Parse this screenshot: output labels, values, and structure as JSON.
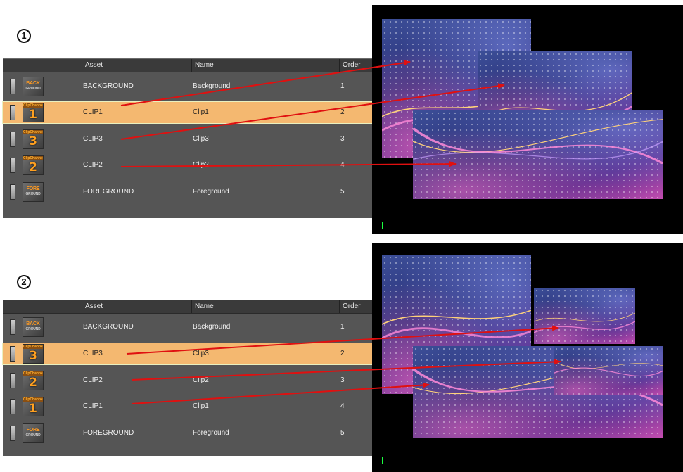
{
  "colors": {
    "panel": "#555555",
    "header": "#3a3a3a",
    "selected_row": "#f4b870",
    "arrow": "#e01010",
    "thumb_orange": "#ffa020"
  },
  "steps": [
    {
      "badge": "1",
      "columns": {
        "asset": "Asset",
        "name": "Name",
        "order": "Order"
      },
      "rows": [
        {
          "thumb": "background-thumb-icon",
          "thumb_text": "BACK",
          "thumb_sub": "GROUND",
          "asset": "BACKGROUND",
          "name": "Background",
          "order": "1",
          "selected": false
        },
        {
          "thumb": "clip-thumb-icon",
          "thumb_tag": "ClipChannel",
          "thumb_num": "1",
          "asset": "CLIP1",
          "name": "Clip1",
          "order": "2",
          "selected": true
        },
        {
          "thumb": "clip-thumb-icon",
          "thumb_tag": "ClipChannel",
          "thumb_num": "3",
          "asset": "CLIP3",
          "name": "Clip3",
          "order": "3",
          "selected": false
        },
        {
          "thumb": "clip-thumb-icon",
          "thumb_tag": "ClipChannel",
          "thumb_num": "2",
          "asset": "CLIP2",
          "name": "Clip2",
          "order": "4",
          "selected": false
        },
        {
          "thumb": "foreground-thumb-icon",
          "thumb_text": "FORE",
          "thumb_sub": "GROUND",
          "asset": "FOREGROUND",
          "name": "Foreground",
          "order": "5",
          "selected": false
        }
      ]
    },
    {
      "badge": "2",
      "columns": {
        "asset": "Asset",
        "name": "Name",
        "order": "Order"
      },
      "rows": [
        {
          "thumb": "background-thumb-icon",
          "thumb_text": "BACK",
          "thumb_sub": "GROUND",
          "asset": "BACKGROUND",
          "name": "Background",
          "order": "1",
          "selected": false
        },
        {
          "thumb": "clip-thumb-icon",
          "thumb_tag": "ClipChannel",
          "thumb_num": "3",
          "asset": "CLIP3",
          "name": "Clip3",
          "order": "2",
          "selected": true
        },
        {
          "thumb": "clip-thumb-icon",
          "thumb_tag": "ClipChannel",
          "thumb_num": "2",
          "asset": "CLIP2",
          "name": "Clip2",
          "order": "3",
          "selected": false
        },
        {
          "thumb": "clip-thumb-icon",
          "thumb_tag": "ClipChannel",
          "thumb_num": "1",
          "asset": "CLIP1",
          "name": "Clip1",
          "order": "4",
          "selected": false
        },
        {
          "thumb": "foreground-thumb-icon",
          "thumb_text": "FORE",
          "thumb_sub": "GROUND",
          "asset": "FOREGROUND",
          "name": "Foreground",
          "order": "5",
          "selected": false
        }
      ]
    }
  ]
}
